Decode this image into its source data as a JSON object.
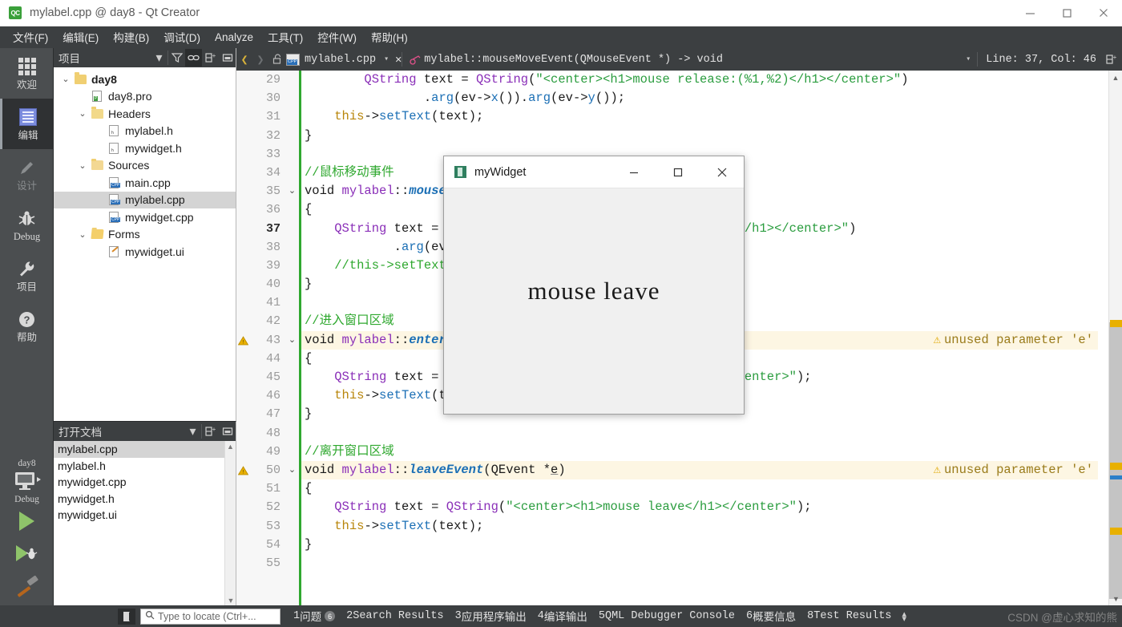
{
  "window": {
    "title": "mylabel.cpp @ day8 - Qt Creator",
    "logo_text": "QC",
    "controls": {
      "minimize": "minimize-icon",
      "maximize": "maximize-icon",
      "close": "close-icon"
    }
  },
  "menubar": {
    "items": [
      {
        "label": "文件(F)",
        "mnemonic": "F"
      },
      {
        "label": "编辑(E)",
        "mnemonic": "E"
      },
      {
        "label": "构建(B)",
        "mnemonic": "B"
      },
      {
        "label": "调试(D)",
        "mnemonic": "D"
      },
      {
        "label": "Analyze",
        "mnemonic": "A"
      },
      {
        "label": "工具(T)",
        "mnemonic": "T"
      },
      {
        "label": "控件(W)",
        "mnemonic": "W"
      },
      {
        "label": "帮助(H)",
        "mnemonic": "H"
      }
    ]
  },
  "modebar": {
    "items": [
      {
        "label": "欢迎",
        "icon": "grid-icon",
        "state": "normal"
      },
      {
        "label": "编辑",
        "icon": "document-icon",
        "state": "active"
      },
      {
        "label": "设计",
        "icon": "pencil-icon",
        "state": "disabled"
      },
      {
        "label": "Debug",
        "icon": "bug-icon",
        "state": "normal"
      },
      {
        "label": "项目",
        "icon": "wrench-icon",
        "state": "normal"
      },
      {
        "label": "帮助",
        "icon": "question-circle-icon",
        "state": "normal"
      }
    ],
    "kit": {
      "project": "day8",
      "config": "Debug",
      "icon": "monitor-icon"
    },
    "actions": [
      {
        "name": "run-button",
        "icon": "play-icon"
      },
      {
        "name": "debug-button",
        "icon": "play-bug-icon"
      },
      {
        "name": "build-button",
        "icon": "hammer-icon"
      }
    ]
  },
  "project_panel": {
    "title": "项目",
    "tools": [
      "chevron-down-icon",
      "filter-icon",
      "link-icon",
      "add-split-icon",
      "minimize-panel-icon"
    ],
    "tree": [
      {
        "label": "day8",
        "indent": 0,
        "chev": "v",
        "icon": "folder-project",
        "bold": true,
        "selected": false
      },
      {
        "label": "day8.pro",
        "indent": 1,
        "chev": "",
        "icon": "file-pro",
        "bold": false,
        "selected": false
      },
      {
        "label": "Headers",
        "indent": 1,
        "chev": "v",
        "icon": "folder-headers",
        "bold": false,
        "selected": false
      },
      {
        "label": "mylabel.h",
        "indent": 2,
        "chev": "",
        "icon": "file-h",
        "bold": false,
        "selected": false
      },
      {
        "label": "mywidget.h",
        "indent": 2,
        "chev": "",
        "icon": "file-h",
        "bold": false,
        "selected": false
      },
      {
        "label": "Sources",
        "indent": 1,
        "chev": "v",
        "icon": "folder-sources",
        "bold": false,
        "selected": false
      },
      {
        "label": "main.cpp",
        "indent": 2,
        "chev": "",
        "icon": "file-cpp",
        "bold": false,
        "selected": false
      },
      {
        "label": "mylabel.cpp",
        "indent": 2,
        "chev": "",
        "icon": "file-cpp",
        "bold": false,
        "selected": true
      },
      {
        "label": "mywidget.cpp",
        "indent": 2,
        "chev": "",
        "icon": "file-cpp",
        "bold": false,
        "selected": false
      },
      {
        "label": "Forms",
        "indent": 1,
        "chev": "v",
        "icon": "folder-forms",
        "bold": false,
        "selected": false
      },
      {
        "label": "mywidget.ui",
        "indent": 2,
        "chev": "",
        "icon": "file-ui",
        "bold": false,
        "selected": false
      }
    ]
  },
  "open_documents_panel": {
    "title": "打开文档",
    "tools": [
      "chevron-down-icon",
      "add-split-icon",
      "minimize-panel-icon"
    ],
    "items": [
      {
        "label": "mylabel.cpp",
        "selected": true
      },
      {
        "label": "mylabel.h",
        "selected": false
      },
      {
        "label": "mywidget.cpp",
        "selected": false
      },
      {
        "label": "mywidget.h",
        "selected": false
      },
      {
        "label": "mywidget.ui",
        "selected": false
      }
    ]
  },
  "editor_toolbar": {
    "back_icon": "chevron-left-icon",
    "forward_icon": "chevron-right-icon",
    "lock_icon": "unlocked-icon",
    "file_combo": "mylabel.cpp",
    "close_icon": "close-icon",
    "symbol_combo": "mylabel::mouseMoveEvent(QMouseEvent *) -> void",
    "cursor_position": "Line: 37, Col: 46",
    "split_icon": "split-editor-icon"
  },
  "editor": {
    "first_line": 29,
    "current_line": 37,
    "lines": [
      {
        "n": 29,
        "fold": "",
        "warn": false,
        "html": "        <span class='type'>QString</span> text <span class='op'>=</span> <span class='type'>QString</span><span class='op'>(</span><span class='str'>\"&lt;center&gt;&lt;h1&gt;mouse release:(%1,%2)&lt;/h1&gt;&lt;/center&gt;\"</span><span class='op'>)</span>"
      },
      {
        "n": 30,
        "fold": "",
        "warn": false,
        "html": "                <span class='op'>.</span><span class='fn'>arg</span><span class='op'>(</span>ev<span class='op'>-&gt;</span><span class='fn'>x</span><span class='op'>()).</span><span class='fn'>arg</span><span class='op'>(</span>ev<span class='op'>-&gt;</span><span class='fn'>y</span><span class='op'>());</span>"
      },
      {
        "n": 31,
        "fold": "",
        "warn": false,
        "html": "    <span class='this'>this</span><span class='op'>-&gt;</span><span class='fn'>setText</span><span class='op'>(</span>text<span class='op'>);</span>"
      },
      {
        "n": 32,
        "fold": "",
        "warn": false,
        "html": "<span class='op'>}</span>"
      },
      {
        "n": 33,
        "fold": "",
        "warn": false,
        "html": ""
      },
      {
        "n": 34,
        "fold": "",
        "warn": false,
        "html": "<span class='cmt'>//鼠标移动事件</span>"
      },
      {
        "n": 35,
        "fold": "v",
        "warn": false,
        "html": "<span class='kw2'>void</span> <span class='cls'>mylabel</span><span class='op'>::</span><span class='fnb'>mouseMoveEvent</span><span class='op'>(</span>QMouseEvent <span class='op'>*</span>ev<span class='op'>)</span>"
      },
      {
        "n": 36,
        "fold": "",
        "warn": false,
        "html": "<span class='op'>{</span>"
      },
      {
        "n": 37,
        "fold": "",
        "warn": false,
        "html": "    <span class='type'>QString</span> text <span class='op'>=</span> <span class='type'>QString</span><span class='op'>(</span><span class='str'>\"&lt;center&gt;&lt;h1&gt;mouse move:(%1,%2)&lt;/h1&gt;&lt;/center&gt;\"</span><span class='op'>)</span>"
      },
      {
        "n": 38,
        "fold": "",
        "warn": false,
        "html": "            <span class='op'>.</span><span class='fn'>arg</span><span class='op'>(</span>ev<span class='op'>-&gt;</span><span class='fn'>x</span><span class='op'>()).</span><span class='fn'>arg</span><span class='op'>(</span>ev<span class='op'>-&gt;</span><span class='fn'>y</span><span class='op'>());</span>"
      },
      {
        "n": 39,
        "fold": "",
        "warn": false,
        "html": "    <span class='cmt'>//this-&gt;setText(text);</span>"
      },
      {
        "n": 40,
        "fold": "",
        "warn": false,
        "html": "<span class='op'>}</span>"
      },
      {
        "n": 41,
        "fold": "",
        "warn": false,
        "html": ""
      },
      {
        "n": 42,
        "fold": "",
        "warn": false,
        "html": "<span class='cmt'>//进入窗口区域</span>"
      },
      {
        "n": 43,
        "fold": "v",
        "warn": true,
        "annotation": "unused parameter 'e'",
        "html": "<span class='kw2'>void</span> <span class='cls'>mylabel</span><span class='op'>::</span><span class='fnb'>enterEvent</span><span class='op'>(</span>QEvent <span class='op'>*</span><span class='undl'>e</span><span class='op'>)</span>"
      },
      {
        "n": 44,
        "fold": "",
        "warn": false,
        "html": "<span class='op'>{</span>"
      },
      {
        "n": 45,
        "fold": "",
        "warn": false,
        "html": "    <span class='type'>QString</span> text <span class='op'>=</span> <span class='type'>QString</span><span class='op'>(</span><span class='str'>\"&lt;center&gt;&lt;h1&gt;mouse enter&lt;/h1&gt;&lt;/center&gt;\"</span><span class='op'>);</span>"
      },
      {
        "n": 46,
        "fold": "",
        "warn": false,
        "html": "    <span class='this'>this</span><span class='op'>-&gt;</span><span class='fn'>setText</span><span class='op'>(</span>text<span class='op'>);</span>"
      },
      {
        "n": 47,
        "fold": "",
        "warn": false,
        "html": "<span class='op'>}</span>"
      },
      {
        "n": 48,
        "fold": "",
        "warn": false,
        "html": ""
      },
      {
        "n": 49,
        "fold": "",
        "warn": false,
        "html": "<span class='cmt'>//离开窗口区域</span>"
      },
      {
        "n": 50,
        "fold": "v",
        "warn": true,
        "annotation": "unused parameter 'e'",
        "html": "<span class='kw2'>void</span> <span class='cls'>mylabel</span><span class='op'>::</span><span class='fnb'>leaveEvent</span><span class='op'>(</span>QEvent <span class='op'>*</span><span class='undl'>e</span><span class='op'>)</span>"
      },
      {
        "n": 51,
        "fold": "",
        "warn": false,
        "html": "<span class='op'>{</span>"
      },
      {
        "n": 52,
        "fold": "",
        "warn": false,
        "html": "    <span class='type'>QString</span> text <span class='op'>=</span> <span class='type'>QString</span><span class='op'>(</span><span class='str'>\"&lt;center&gt;&lt;h1&gt;mouse leave&lt;/h1&gt;&lt;/center&gt;\"</span><span class='op'>);</span>"
      },
      {
        "n": 53,
        "fold": "",
        "warn": false,
        "html": "    <span class='this'>this</span><span class='op'>-&gt;</span><span class='fn'>setText</span><span class='op'>(</span>text<span class='op'>);</span>"
      },
      {
        "n": 54,
        "fold": "",
        "warn": false,
        "html": "<span class='op'>}</span>"
      },
      {
        "n": 55,
        "fold": "",
        "warn": false,
        "html": ""
      }
    ]
  },
  "popup_window": {
    "title": "myWidget",
    "icon": "app-icon",
    "body_text": "mouse leave",
    "controls": {
      "minimize": "minimize-icon",
      "maximize": "maximize-icon",
      "close": "close-icon"
    }
  },
  "statusbar": {
    "sidebar_toggle_icon": "toggle-sidebar-icon",
    "locator_placeholder": "Type to locate (Ctrl+...",
    "locator_icon": "search-icon",
    "items": [
      {
        "num": "1",
        "label": "问题",
        "badge": "6"
      },
      {
        "num": "2",
        "label": "Search Results",
        "badge": ""
      },
      {
        "num": "3",
        "label": "应用程序输出",
        "badge": ""
      },
      {
        "num": "4",
        "label": "编译输出",
        "badge": ""
      },
      {
        "num": "5",
        "label": "QML Debugger Console",
        "badge": ""
      },
      {
        "num": "6",
        "label": "概要信息",
        "badge": ""
      },
      {
        "num": "8",
        "label": "Test Results",
        "badge": ""
      }
    ],
    "watermark": "CSDN @虚心求知的熊"
  },
  "colors": {
    "chrome": "#3c3f41",
    "modebar": "#4b4e50",
    "accent_green": "#2fa82f",
    "warning": "#e0a800",
    "string": "#2b9d3f",
    "type": "#8a2fb8",
    "function": "#1b6fb5"
  }
}
